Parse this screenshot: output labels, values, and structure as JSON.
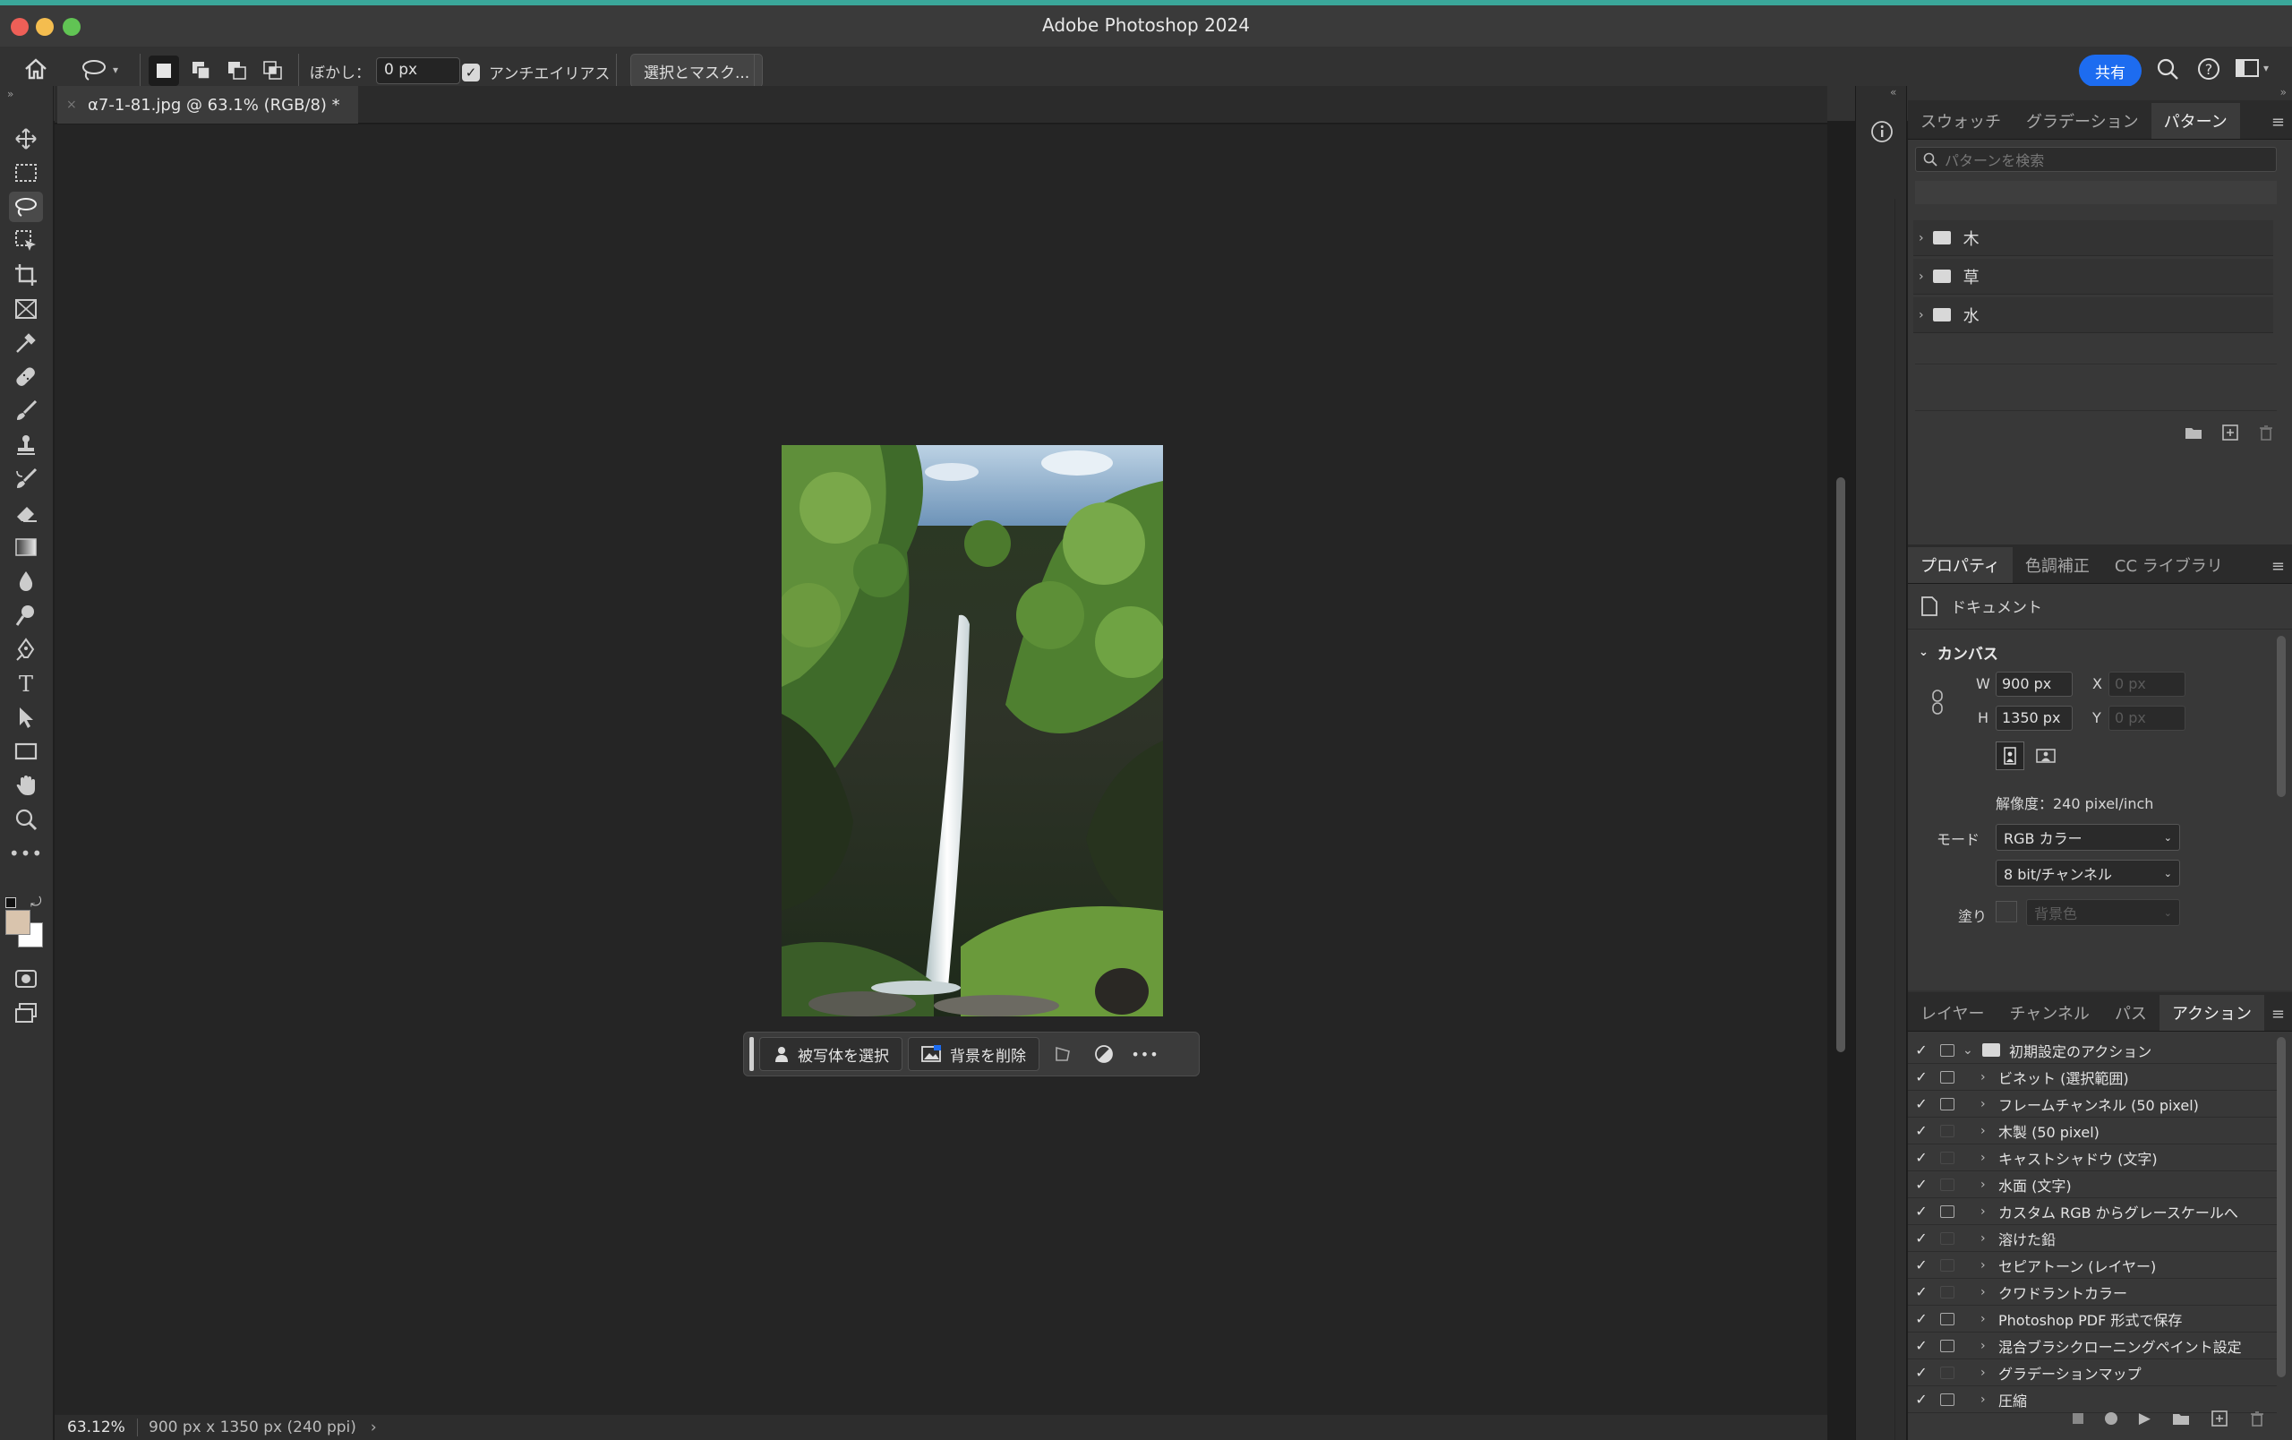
{
  "app": {
    "title": "Adobe Photoshop 2024"
  },
  "options_bar": {
    "feather_label": "ぼかし：",
    "feather_value": "0 px",
    "antialias_label": "アンチエイリアス",
    "select_mask_label": "選択とマスク...",
    "share_label": "共有"
  },
  "document": {
    "tab_title": "α7-1-81.jpg @ 63.1% (RGB/8) *",
    "zoom": "63.12%",
    "info": "900 px x 1350 px (240 ppi)"
  },
  "taskbar": {
    "select_subject": "被写体を選択",
    "remove_background": "背景を削除"
  },
  "pattern_panel": {
    "tabs": [
      "スウォッチ",
      "グラデーション",
      "パターン"
    ],
    "active_tab": "パターン",
    "search_placeholder": "パターンを検索",
    "folders": [
      "木",
      "草",
      "水"
    ]
  },
  "properties_panel": {
    "tabs": [
      "プロパティ",
      "色調補正",
      "CC ライブラリ"
    ],
    "active_tab": "プロパティ",
    "doc_label": "ドキュメント",
    "section": "カンバス",
    "w_label": "W",
    "w_value": "900 px",
    "h_label": "H",
    "h_value": "1350 px",
    "x_label": "X",
    "x_value": "0 px",
    "y_label": "Y",
    "y_value": "0 px",
    "resolution": "解像度：240 pixel/inch",
    "mode_label": "モード",
    "mode_value": "RGB カラー",
    "bit_value": "8 bit/チャンネル",
    "fill_label": "塗り",
    "fill_value": "背景色"
  },
  "actions_panel": {
    "tabs": [
      "レイヤー",
      "チャンネル",
      "パス",
      "アクション"
    ],
    "active_tab": "アクション",
    "set_name": "初期設定のアクション",
    "items": [
      {
        "label": "ビネット (選択範囲)",
        "dialog": true
      },
      {
        "label": "フレームチャンネル (50 pixel)",
        "dialog": true
      },
      {
        "label": "木製 (50 pixel)",
        "dialog": false
      },
      {
        "label": "キャストシャドウ (文字)",
        "dialog": false
      },
      {
        "label": "水面 (文字)",
        "dialog": false
      },
      {
        "label": "カスタム RGB からグレースケールへ",
        "dialog": true
      },
      {
        "label": "溶けた鉛",
        "dialog": false
      },
      {
        "label": "セピアトーン (レイヤー)",
        "dialog": false
      },
      {
        "label": "クワドラントカラー",
        "dialog": false
      },
      {
        "label": "Photoshop PDF 形式で保存",
        "dialog": true
      },
      {
        "label": "混合ブラシクローニングペイント設定",
        "dialog": true
      },
      {
        "label": "グラデーションマップ",
        "dialog": false
      },
      {
        "label": "圧縮",
        "dialog": true
      }
    ]
  },
  "colors": {
    "foreground": "#d9c4ad",
    "background": "#ffffff",
    "accent": "#1d6cf0"
  }
}
